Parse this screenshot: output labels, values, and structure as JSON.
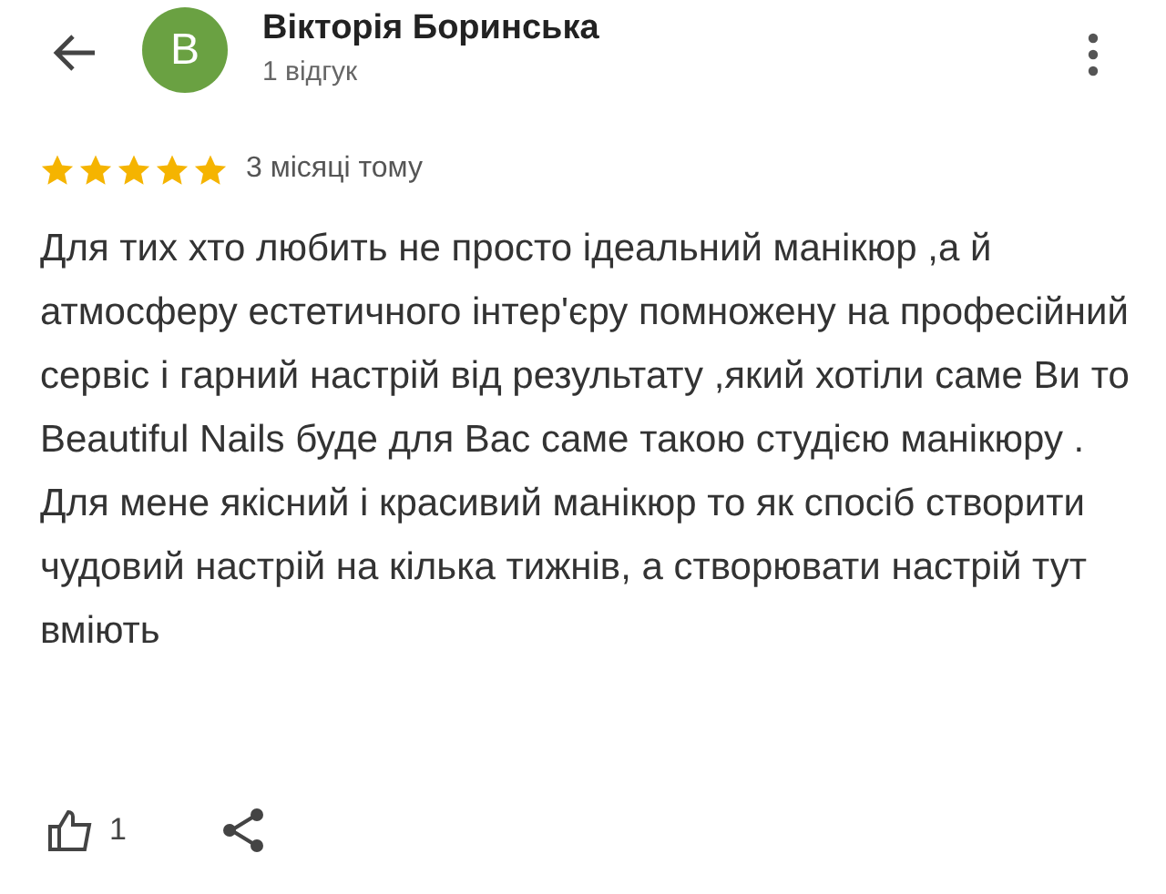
{
  "reviewer": {
    "initial": "B",
    "name": "Вікторія Боринська",
    "review_count": "1 відгук"
  },
  "review": {
    "stars": 5,
    "time": "3 місяці тому",
    "text": "Для тих хто любить не просто ідеальний манікюр ,а й атмосферу естетичного інтер'єру помножену на професійний сервіс і гарний настрій від результату ,який хотіли саме Ви то Beautiful Nails буде для Вас саме такою студією манікюру . Для мене якісний і красивий манікюр то як спосіб створити чудовий настрій на кілька тижнів, а створювати настрій тут вміють"
  },
  "actions": {
    "likes": "1"
  }
}
